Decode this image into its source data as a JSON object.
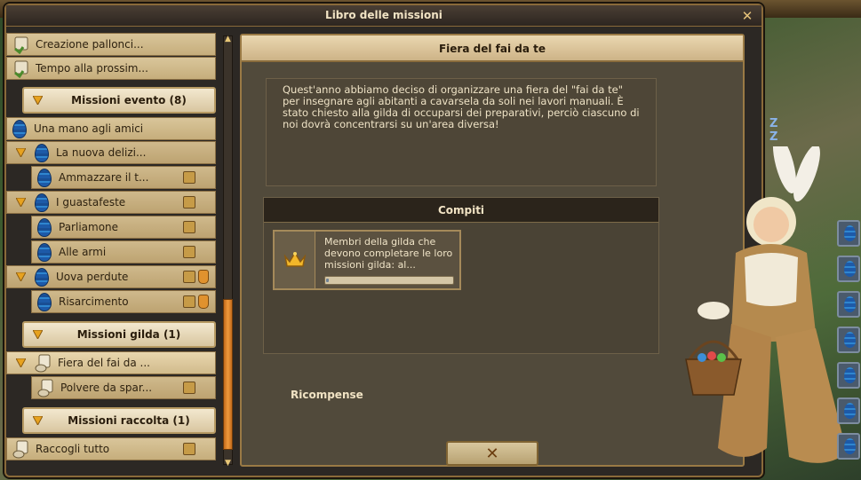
{
  "window": {
    "title": "Libro delle missioni",
    "close_icon": "close-icon"
  },
  "quest_list": {
    "items": [
      {
        "kind": "row",
        "label": "Creazione pallonci...",
        "icon": "scroll-icon"
      },
      {
        "kind": "row",
        "label": "Tempo alla prossim...",
        "icon": "scroll-icon"
      },
      {
        "kind": "header",
        "label": "Missioni evento (8)"
      },
      {
        "kind": "row",
        "label": "Una mano agli amici",
        "icon": "egg-icon"
      },
      {
        "kind": "row",
        "label": "La nuova delizi...",
        "icon": "egg-icon"
      },
      {
        "kind": "row",
        "label": "Ammazzare il t...",
        "icon": "egg-icon"
      },
      {
        "kind": "row",
        "label": "I guastafeste",
        "icon": "egg-icon"
      },
      {
        "kind": "row",
        "label": "Parliamone",
        "icon": "egg-icon"
      },
      {
        "kind": "row",
        "label": "Alle armi",
        "icon": "egg-icon"
      },
      {
        "kind": "row",
        "label": "Uova perdute",
        "icon": "egg-icon"
      },
      {
        "kind": "row",
        "label": "Risarcimento",
        "icon": "egg-icon"
      },
      {
        "kind": "header",
        "label": "Missioni gilda (1)"
      },
      {
        "kind": "row",
        "label": "Fiera del fai da ...",
        "icon": "scroll-hand-icon"
      },
      {
        "kind": "row",
        "label": "Polvere da spar...",
        "icon": "scroll-hand-icon"
      },
      {
        "kind": "header",
        "label": "Missioni raccolta (1)"
      },
      {
        "kind": "row",
        "label": "Raccogli tutto",
        "icon": "scroll-hand-icon"
      }
    ]
  },
  "detail": {
    "title": "Fiera del fai da te",
    "description": "Quest'anno abbiamo deciso di organizzare una fiera del \"fai da te\" per insegnare agli abitanti a cavarsela da soli nei lavori manuali. È stato chiesto alla gilda di occuparsi dei preparativi, perciò ciascuno di noi dovrà concentrarsi su un'area diversa!",
    "tasks_header": "Compiti",
    "task": {
      "text": "Membri della gilda che devono completare le loro missioni gilda: al...",
      "icon": "crown-icon",
      "progress": 0.02
    },
    "rewards_label": "Ricompense",
    "close_button_icon": "close-icon"
  }
}
